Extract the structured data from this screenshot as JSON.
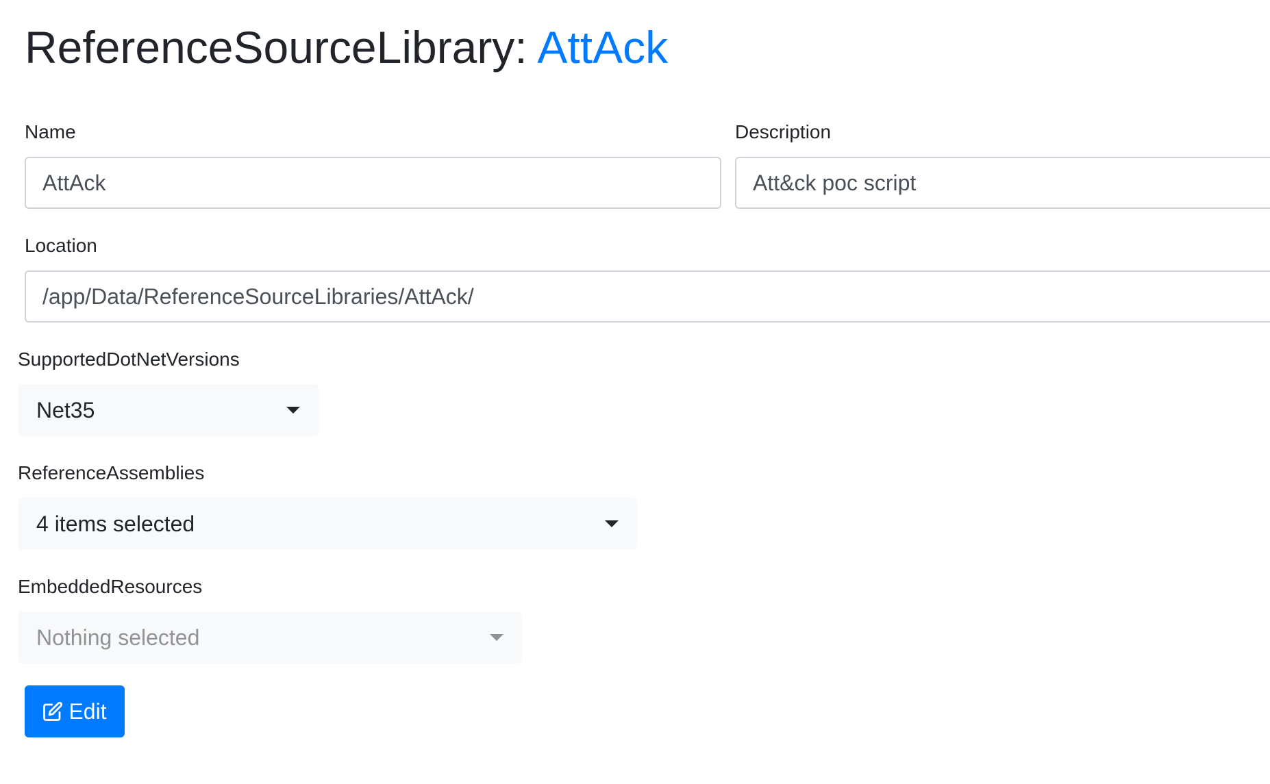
{
  "header": {
    "prefix": "ReferenceSourceLibrary: ",
    "name_link": "AttAck"
  },
  "form": {
    "name": {
      "label": "Name",
      "value": "AttAck"
    },
    "description": {
      "label": "Description",
      "value": "Att&ck poc script"
    },
    "location": {
      "label": "Location",
      "value": "/app/Data/ReferenceSourceLibraries/AttAck/"
    },
    "supported_dotnet_versions": {
      "label": "SupportedDotNetVersions",
      "selected": "Net35"
    },
    "reference_assemblies": {
      "label": "ReferenceAssemblies",
      "selected": "4 items selected"
    },
    "embedded_resources": {
      "label": "EmbeddedResources",
      "selected": "Nothing selected"
    }
  },
  "actions": {
    "edit_label": "Edit"
  },
  "colors": {
    "primary": "#007bff",
    "text": "#212529",
    "muted": "#909294",
    "select_bg": "#f8f9fa",
    "input_border": "#ced4da"
  },
  "icons": {
    "edit": "pencil-square-icon",
    "dropdown": "caret-down-icon"
  }
}
